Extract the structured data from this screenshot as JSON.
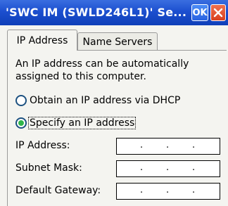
{
  "window": {
    "title": "'SWC IM (SWLD246L1)' Se...",
    "ok_label": "OK"
  },
  "tabs": [
    {
      "label": "IP Address",
      "active": true
    },
    {
      "label": "Name Servers",
      "active": false
    }
  ],
  "content": {
    "description_line1": "An IP address can be automatically",
    "description_line2": "assigned to this computer.",
    "radio_dhcp": {
      "label": "Obtain an IP address via DHCP",
      "selected": false
    },
    "radio_specify": {
      "label": "Specify an IP address",
      "selected": true
    }
  },
  "fields": [
    {
      "label": "IP Address:",
      "value": "   .   .   ."
    },
    {
      "label": "Subnet Mask:",
      "value": "   .   .   ."
    },
    {
      "label": "Default Gateway:",
      "value": "   .   .   ."
    }
  ],
  "colors": {
    "titlebar": "#1c4fcf",
    "ok_button": "#2a62e0",
    "close_button": "#d8401f",
    "radio_selected": "#2fb54a"
  }
}
